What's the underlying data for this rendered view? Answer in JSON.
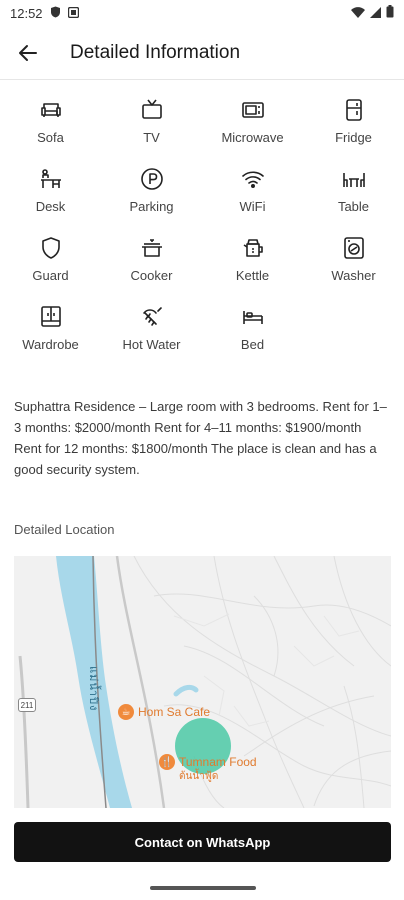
{
  "status_bar": {
    "time": "12:52"
  },
  "header": {
    "title": "Detailed Information"
  },
  "amenities": [
    [
      {
        "label": "Sofa",
        "icon": "sofa-icon"
      },
      {
        "label": "TV",
        "icon": "tv-icon"
      },
      {
        "label": "Microwave",
        "icon": "microwave-icon"
      },
      {
        "label": "Fridge",
        "icon": "fridge-icon"
      }
    ],
    [
      {
        "label": "Desk",
        "icon": "desk-icon"
      },
      {
        "label": "Parking",
        "icon": "parking-icon"
      },
      {
        "label": "WiFi",
        "icon": "wifi-icon"
      },
      {
        "label": "Table",
        "icon": "table-icon"
      }
    ],
    [
      {
        "label": "Guard",
        "icon": "shield-icon"
      },
      {
        "label": "Cooker",
        "icon": "cooker-icon"
      },
      {
        "label": "Kettle",
        "icon": "kettle-icon"
      },
      {
        "label": "Washer",
        "icon": "washer-icon"
      }
    ],
    [
      {
        "label": "Wardrobe",
        "icon": "wardrobe-icon"
      },
      {
        "label": "Hot Water",
        "icon": "hot-water-icon"
      },
      {
        "label": "Bed",
        "icon": "bed-icon"
      }
    ]
  ],
  "description": "Suphattra Residence – Large room with 3 bedrooms.  Rent for 1–3 months: $2000/month  Rent for 4–11 months: $1900/month  Rent for 12 months: $1800/month The place is clean and has a good security system.",
  "location": {
    "label": "Detailed Location",
    "map": {
      "poi_1": "Hom Sa Cafe",
      "poi_2": "Tumnam Food",
      "poi_2_sub": "ต้นน้ำฟู้ด",
      "river_label": "แม่น้ำปิง",
      "road_number": "211"
    }
  },
  "cta": {
    "label": "Contact on WhatsApp"
  },
  "colors": {
    "accent": "#121212",
    "river": "#a8d8ea",
    "marker": "#4cc9a6",
    "poi": "#f08a3c"
  }
}
